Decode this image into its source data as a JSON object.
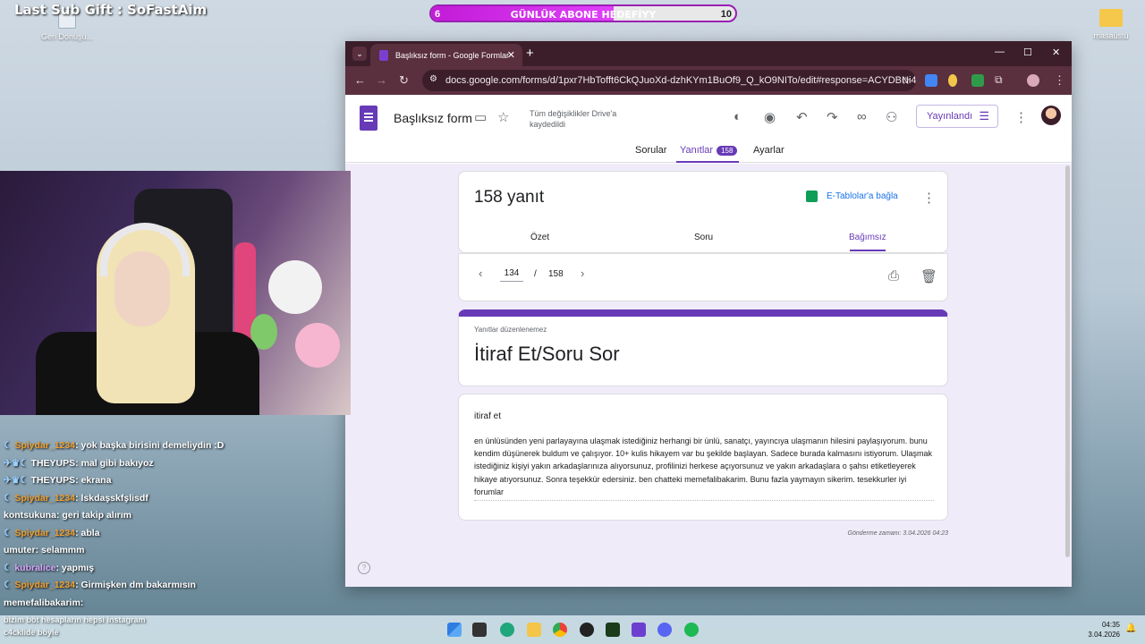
{
  "overlay": {
    "sub_gift": "Last Sub Gift : SoFastAim",
    "goal_label": "GÜNLÜK ABONE HEDEFİYY",
    "goal_current": "6",
    "goal_target": "10",
    "goal_progress": 0.6
  },
  "desktop": {
    "recycle_label": "Geri Dönüşü...",
    "folder_label": "masaüstü"
  },
  "browser": {
    "tab_title": "Başlıksız form - Google Formlar",
    "url": "docs.google.com/forms/d/1pxr7HbTofft6CkQJuoXd-dzhKYm1BuOf9_Q_kO9NITo/edit#response=ACYDBNi4dl..."
  },
  "forms": {
    "title": "Başlıksız form",
    "saved_status": "Tüm değişiklikler Drive'a kaydedildi",
    "publish_label": "Yayınlandı",
    "tabs": [
      {
        "label": "Sorular"
      },
      {
        "label": "Yanıtlar",
        "badge": "158"
      },
      {
        "label": "Ayarlar"
      }
    ],
    "responses": {
      "count_label": "158 yanıt",
      "sheets_link": "E-Tablolar'a bağla",
      "subtabs": [
        "Özet",
        "Soru",
        "Bağımsız"
      ],
      "current": "134",
      "separator": "/",
      "total": "158"
    },
    "title_card": {
      "no_edit": "Yanıtlar düzenlenemez",
      "form_heading": "İtiraf Et/Soru Sor"
    },
    "question": {
      "title": "itiraf et",
      "answer": "en ünlüsünden yeni parlayayına ulaşmak istediğiniz herhangi bir ünlü, sanatçı, yayıncıya ulaşmanın hilesini paylaşıyorum. bunu kendim düşünerek buldum ve çalışıyor. 10+ kulis hikayem var bu şekilde başlayan. Sadece burada kalmasını istiyorum. Ulaşmak istediğiniz kişiyi yakın arkadaşlarınıza alıyorsunuz, profilinizi herkese açıyorsunuz ve yakın arkadaşlara o şahsı etiketleyerek hikaye atıyorsunuz. Sonra teşekkür edersiniz. ben chatteki memefalibakarim. Bunu fazla yaymayın sikerim. tesekkurler iyi forumlar"
    },
    "submitted_at": "Gönderme zamanı: 3.04.2026 04:23",
    "help": "?"
  },
  "chat": [
    {
      "user": "Spiydar_1234",
      "msg": "yok başka birisini demeliydin :D",
      "color": "#f0a030",
      "prefix": "☾ "
    },
    {
      "user": "THEYUPS",
      "msg": "mal gibi bakıyoz",
      "color": "#ffffff",
      "prefix": "✈♛☾ "
    },
    {
      "user": "THEYUPS",
      "msg": "ekrana",
      "color": "#ffffff",
      "prefix": "✈♛☾ "
    },
    {
      "user": "Spiydar_1234",
      "msg": "lskdaşskfşlisdf",
      "color": "#f0a030",
      "prefix": "☾ "
    },
    {
      "user": "kontsukuna",
      "msg": "geri takip alırım",
      "color": "#ffffff",
      "prefix": ""
    },
    {
      "user": "Spiydar_1234",
      "msg": "abla",
      "color": "#f0a030",
      "prefix": "☾ "
    },
    {
      "user": "umuter",
      "msg": "selammm",
      "color": "#ffffff",
      "prefix": ""
    },
    {
      "user": "kubralice",
      "msg": "yapmış",
      "color": "#d7a6ff",
      "prefix": "☾ "
    },
    {
      "user": "Spiydar_1234",
      "msg": "Girmişken dm bakarmısın",
      "color": "#f0a030",
      "prefix": "☾ "
    },
    {
      "user": "memefalibakarim",
      "msg": "",
      "color": "#ffffff",
      "prefix": ""
    }
  ],
  "chat_partial": {
    "line1": "bizim böt hesapların hepsi instagram",
    "line2": "c4cklide böyle"
  },
  "clock": {
    "time": "04:35",
    "date": "3.04.2026"
  },
  "colors": {
    "accent": "#673ab7",
    "sheets": "#0f9d58",
    "link": "#1a73e8"
  }
}
